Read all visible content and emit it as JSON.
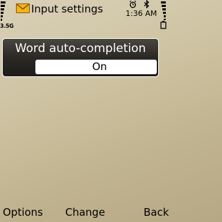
{
  "status_bar": {
    "title": "Input settings",
    "time": "1:36 AM",
    "network": "3.5G",
    "title_icon": "envelope-icon",
    "alarm_icon": "alarm-icon",
    "bluetooth_icon": "bluetooth-icon",
    "signal_strength": 1.0,
    "battery_level": 1.0
  },
  "setting": {
    "label": "Word auto-completion",
    "value": "On"
  },
  "softkeys": {
    "left": "Options",
    "middle": "Change",
    "right": "Back"
  },
  "colors": {
    "panel_dark": "#2b2825",
    "wallpaper": "#cfc4a3",
    "value_box": "#ffffff"
  }
}
